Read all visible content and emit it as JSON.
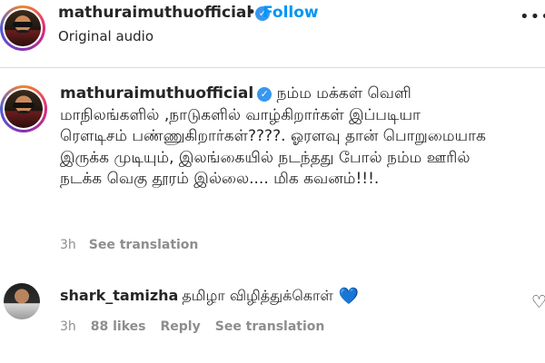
{
  "post_header": {
    "username": "mathuraimuthuofficial",
    "verified_icon": "verified-badge-icon",
    "separator": "•",
    "follow_label": "Follow",
    "subtitle": "Original audio",
    "more_icon": "three-dots-icon"
  },
  "caption": {
    "username": "mathuraimuthuofficial",
    "text": "நம்ம மக்கள் வெளி மாநிலங்களில் ,நாடுகளில் வாழ்கிறார்கள் இப்படியா ரௌடிசம் பண்ணுகிறார்கள்????. ஓரளவு தான் பொறுமையாக இருக்க முடியும், இலங்கையில் நடந்தது போல் நம்ம ஊரில் நடக்க வெகு தூரம் இல்லை.... மிக கவனம்!!!.",
    "time": "3h",
    "see_translation": "See translation"
  },
  "comment": {
    "username": "shark_tamizha",
    "text": "தமிழா விழித்துக்கொள்",
    "emoji": "💙",
    "time": "3h",
    "likes": "88 likes",
    "reply": "Reply",
    "see_translation": "See translation",
    "like_icon": "heart-outline-icon"
  },
  "colors": {
    "accent": "#0095f6",
    "verified": "#3897f0",
    "muted_text": "#8e8e8e"
  }
}
